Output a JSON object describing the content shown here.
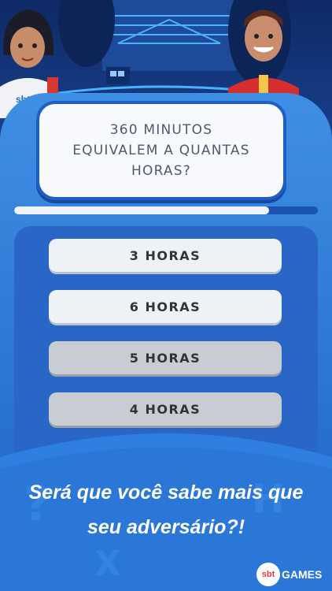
{
  "question": {
    "text": "360 MINUTOS EQUIVALEM A QUANTAS HORAS?"
  },
  "timer": {
    "progress": 0.84
  },
  "answers": [
    {
      "label": "3 HORAS",
      "state": "light"
    },
    {
      "label": "6 HORAS",
      "state": "light"
    },
    {
      "label": "5 HORAS",
      "state": "grey"
    },
    {
      "label": "4 HORAS",
      "state": "grey"
    }
  ],
  "left_player": {
    "shirt_text": "sbt"
  },
  "promo": {
    "line1": "Será que você sabe mais que",
    "line2": "seu adversário?!"
  },
  "brand": {
    "badge": "sbt",
    "name": "GAMES"
  },
  "colors": {
    "primary": "#2b74d1",
    "card_border": "#1f5fc4",
    "button_light": "#eef1f5",
    "button_grey": "#c8ccd3"
  }
}
